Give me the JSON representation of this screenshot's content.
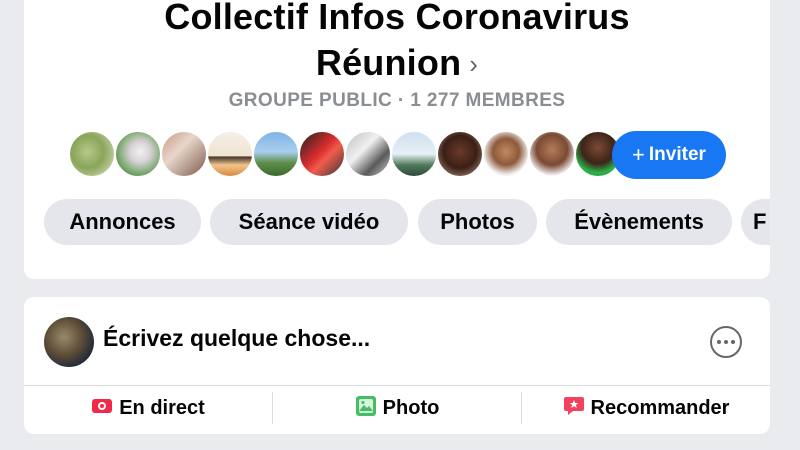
{
  "group": {
    "title_line1": "Collectif Infos Coronavirus",
    "title_line2": "Réunion",
    "title_chevron": "›",
    "subtitle": "GROUPE PUBLIC · 1 277 MEMBRES"
  },
  "members": {
    "invite_label": "Inviter",
    "invite_plus": "+"
  },
  "tabs": [
    {
      "label": "Annonces"
    },
    {
      "label": "Séance vidéo"
    },
    {
      "label": "Photos"
    },
    {
      "label": "Évènements"
    },
    {
      "label": "F"
    }
  ],
  "composer": {
    "prompt": "Écrivez quelque chose...",
    "actions": [
      {
        "label": "En direct",
        "icon": "live-video-icon",
        "color": "#f02849"
      },
      {
        "label": "Photo",
        "icon": "photo-icon",
        "color": "#45bd62"
      },
      {
        "label": "Recommander",
        "icon": "recommend-icon",
        "color": "#f3425f"
      }
    ]
  },
  "colors": {
    "primary": "#1877f2",
    "background": "#e9ebee",
    "tab_bg": "#e4e6eb"
  }
}
